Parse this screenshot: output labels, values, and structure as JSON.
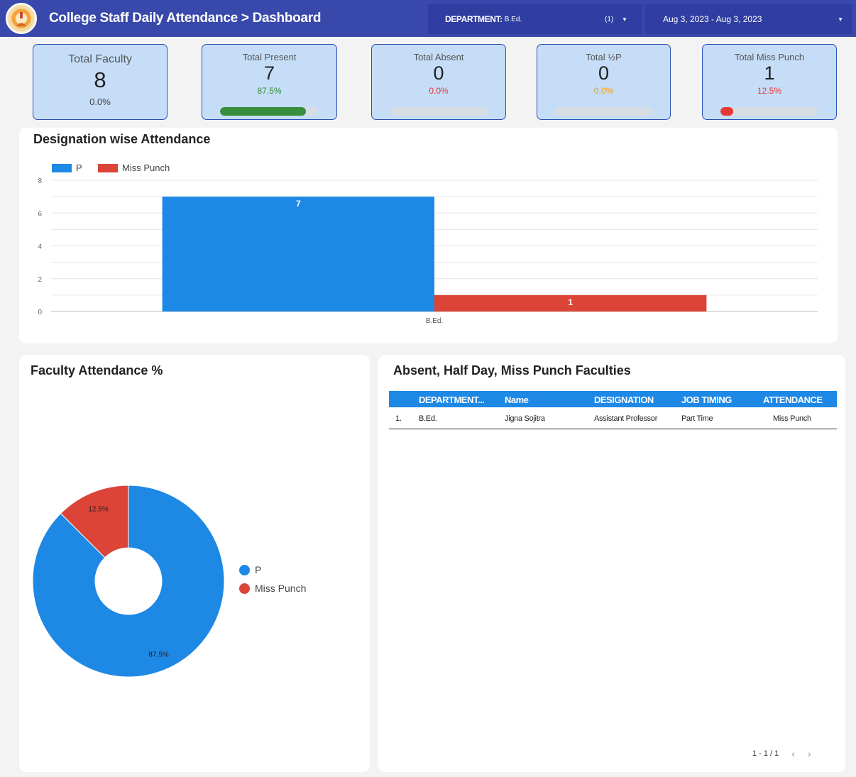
{
  "header": {
    "title": "College Staff Daily Attendance > Dashboard",
    "department_label": "DEPARTMENT:",
    "department_value": "B.Ed.",
    "department_count": "(1)",
    "date_range": "Aug 3, 2023 - Aug 3, 2023",
    "caret_icon": "chevron-down-icon"
  },
  "scorecards": [
    {
      "label": "Total Faculty",
      "value": "8",
      "percent": "0.0%",
      "color": "#444444"
    },
    {
      "label": "Total Present",
      "value": "7",
      "percent": "87.5%",
      "fraction": 0.875,
      "color": "#388e3c"
    },
    {
      "label": "Total Absent",
      "value": "0",
      "percent": "0.0%",
      "fraction": 0,
      "color": "#e53935"
    },
    {
      "label": "Total ½P",
      "value": "0",
      "percent": "0.0%",
      "fraction": 0,
      "color": "#f39c12"
    },
    {
      "label": "Total Miss Punch",
      "value": "1",
      "percent": "12.5%",
      "fraction": 0.125,
      "color": "#e53935"
    }
  ],
  "designation_chart": {
    "title": "Designation wise Attendance"
  },
  "pie_panel": {
    "title": "Faculty Attendance %"
  },
  "chart_data": [
    {
      "type": "bar",
      "categories": [
        "B.Ed."
      ],
      "series": [
        {
          "name": "P",
          "values": [
            7
          ],
          "color": "#1e88e5"
        },
        {
          "name": "Miss Punch",
          "values": [
            1
          ],
          "color": "#db4437"
        }
      ],
      "ylim": [
        0,
        8
      ],
      "yticks": [
        0,
        2,
        4,
        6,
        8
      ],
      "grid": true,
      "legend": "top-left"
    },
    {
      "type": "pie",
      "donut": true,
      "slices": [
        {
          "name": "P",
          "value": 87.5,
          "label": "87.5%",
          "color": "#1e88e5"
        },
        {
          "name": "Miss Punch",
          "value": 12.5,
          "label": "12.5%",
          "color": "#db4437"
        }
      ],
      "legend": "right"
    }
  ],
  "table": {
    "title": "Absent, Half Day, Miss Punch Faculties",
    "columns": [
      "DEPARTMENT...",
      "Name",
      "DESIGNATION",
      "JOB TIMING",
      "ATTENDANCE"
    ],
    "rows": [
      {
        "index": "1.",
        "department": "B.Ed.",
        "name": "Jigna Sojitra",
        "designation": "Assistant Professor",
        "job_timing": "Part Time",
        "attendance": "Miss Punch"
      }
    ],
    "pagination": "1 - 1 / 1",
    "prev_icon": "chevron-left-icon",
    "next_icon": "chevron-right-icon"
  }
}
